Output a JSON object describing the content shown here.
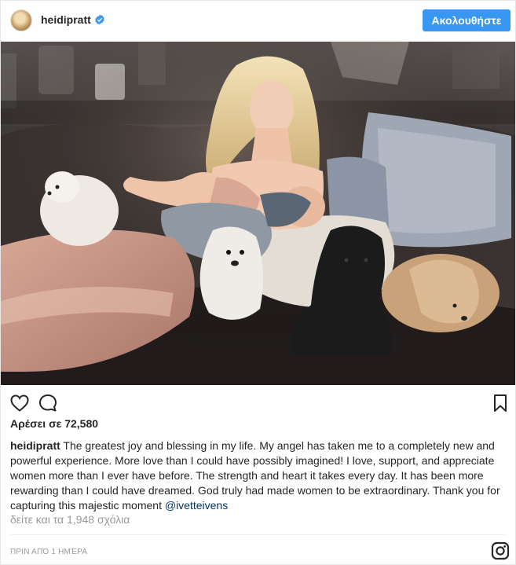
{
  "header": {
    "username": "heidipratt",
    "follow_label": "Ακολουθήστε"
  },
  "photo": {
    "alt": ""
  },
  "icons": {
    "like": "heart-icon",
    "comment": "comment-bubble-icon",
    "save": "bookmark-icon",
    "verified": "verified-badge-icon",
    "brand": "instagram-icon"
  },
  "colors": {
    "follow_button": "#3897f0",
    "verified": "#3897f0",
    "mention": "#003569",
    "muted": "#999999"
  },
  "likes": "Αρέσει σε 72,580",
  "caption": {
    "username": "heidipratt",
    "text_1": " The greatest joy and blessing in my life. My angel has taken me to a completely new and powerful experience. More love than I could have possibly imagined! I love, support, and appreciate women more than I ever have before. The strength and heart it takes every day. It has been more rewarding than I could have dreamed. God truly had made women to be extraordinary. Thank you for capturing this majestic moment ",
    "mention": "@ivetteivens"
  },
  "comments_link": "δείτε και τα 1,948 σχόλια",
  "timestamp": "ΠΡΙΝ ΑΠΌ 1 ΗΜΈΡΑ"
}
